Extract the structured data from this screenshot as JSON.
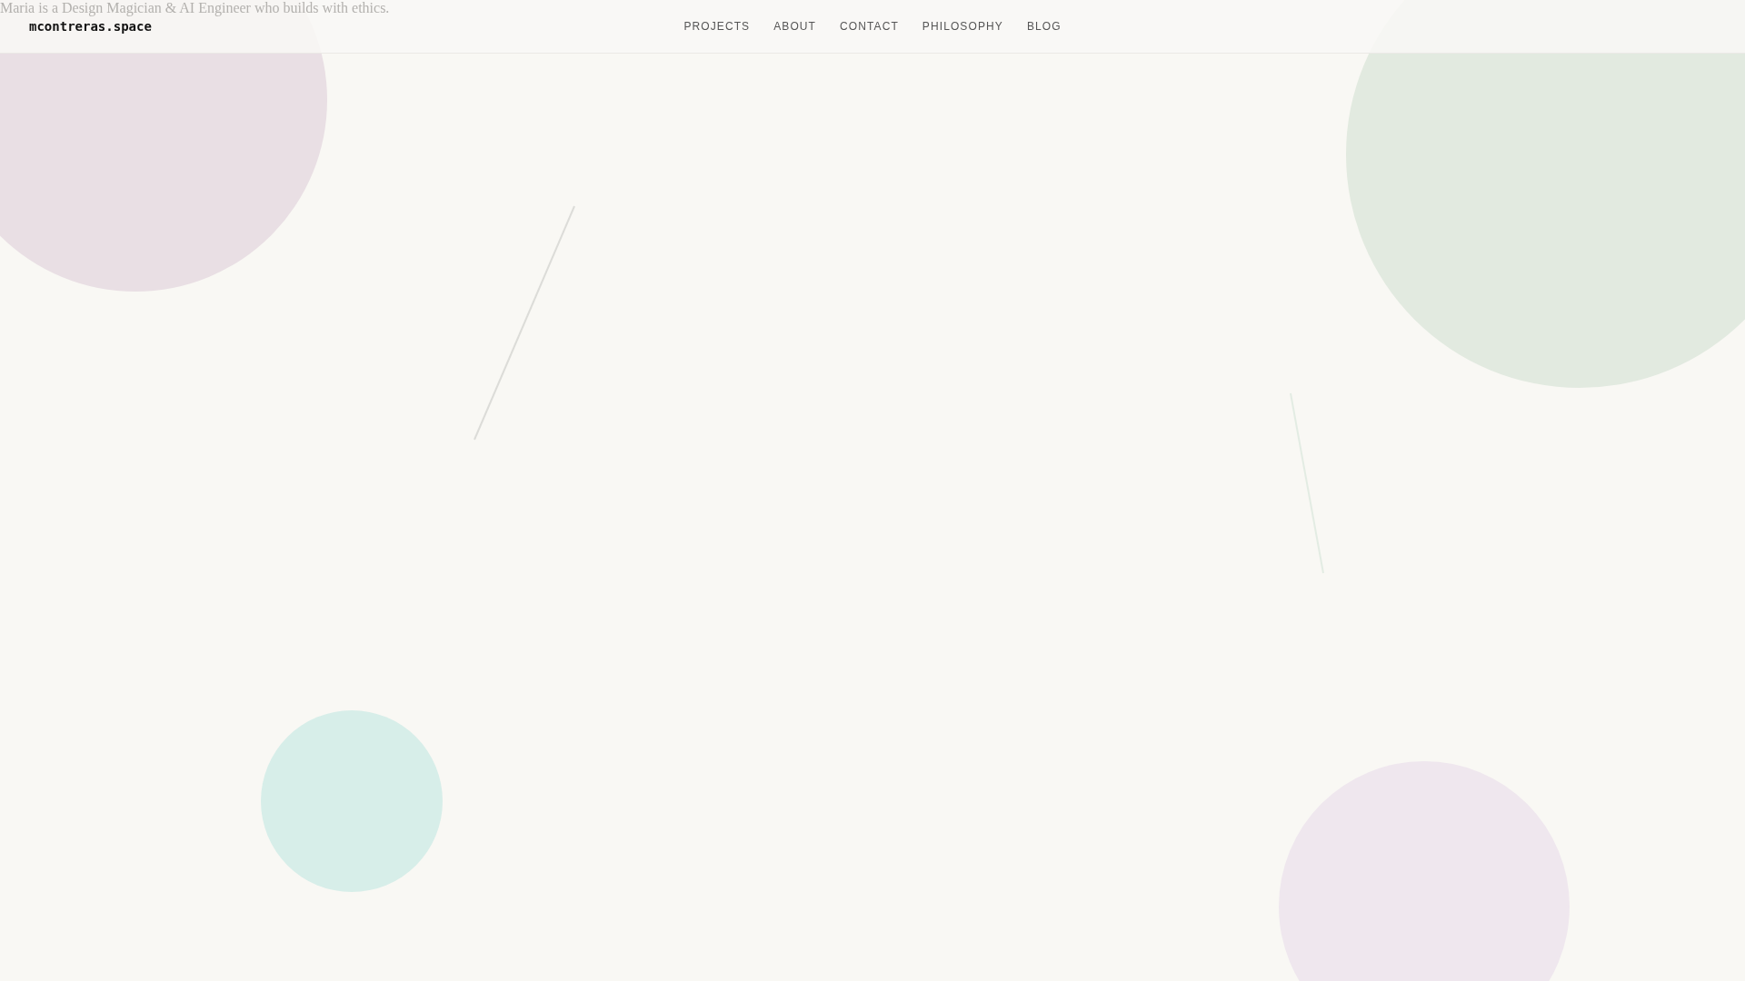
{
  "tagline": "Maria is a Design Magician & AI Engineer who builds with ethics.",
  "header": {
    "logo": "mcontreras.space",
    "nav": [
      "PROJECTS",
      "ABOUT",
      "CONTACT",
      "PHILOSOPHY",
      "BLOG"
    ]
  }
}
